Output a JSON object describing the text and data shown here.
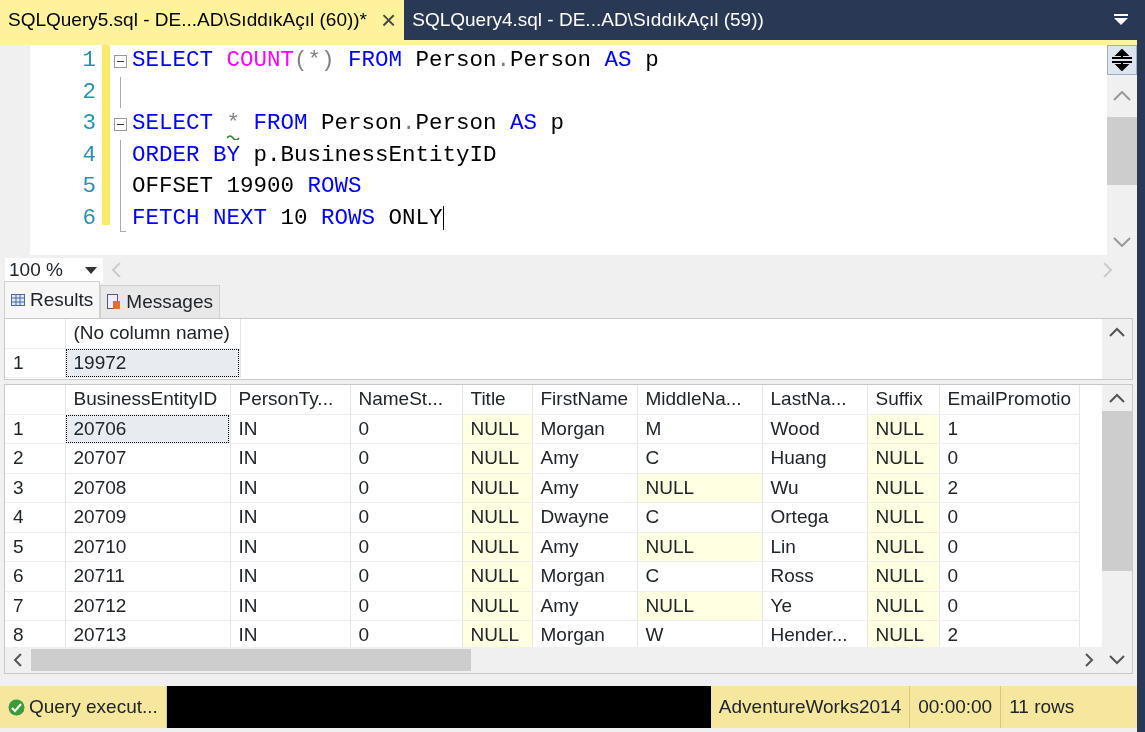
{
  "tabs": [
    {
      "label": "SQLQuery5.sql - DE...AD\\SıddıkAçıl (60))*",
      "selected": true,
      "close": "×"
    },
    {
      "label": "SQLQuery4.sql - DE...AD\\SıddıkAçıl (59))",
      "selected": false
    }
  ],
  "editor": {
    "lines": [
      {
        "number": "1",
        "fold": true,
        "tokens": [
          {
            "kind": "keyword",
            "text": "SELECT"
          },
          {
            "kind": "function",
            "text": " COUNT"
          },
          {
            "kind": "operator",
            "text": "(*)"
          },
          {
            "kind": "keyword",
            "text": " FROM"
          },
          {
            "kind": "plain",
            "text": " Person"
          },
          {
            "kind": "operator",
            "text": "."
          },
          {
            "kind": "plain",
            "text": "Person "
          },
          {
            "kind": "keyword",
            "text": "AS"
          },
          {
            "kind": "plain",
            "text": " p"
          }
        ]
      },
      {
        "number": "2",
        "fold": false
      },
      {
        "number": "3",
        "fold": true,
        "tokens": [
          {
            "kind": "keyword",
            "text": "SELECT "
          },
          {
            "kind": "warning",
            "text": "*"
          },
          {
            "kind": "keyword",
            "text": " FROM"
          },
          {
            "kind": "plain",
            "text": " Person"
          },
          {
            "kind": "operator",
            "text": "."
          },
          {
            "kind": "plain",
            "text": "Person "
          },
          {
            "kind": "keyword",
            "text": "AS"
          },
          {
            "kind": "plain",
            "text": " p"
          }
        ]
      },
      {
        "number": "4",
        "fold": false,
        "tokens": [
          {
            "kind": "keyword",
            "text": "ORDER BY"
          },
          {
            "kind": "plain",
            "text": " p.BusinessEntityID"
          }
        ]
      },
      {
        "number": "5",
        "fold": false,
        "tokens": [
          {
            "kind": "plain",
            "text": "OFFSET 19900 "
          },
          {
            "kind": "keyword",
            "text": "ROWS"
          }
        ]
      },
      {
        "number": "6",
        "fold": false,
        "tokens": [
          {
            "kind": "keyword",
            "text": "FETCH NEXT"
          },
          {
            "kind": "plain",
            "text": " 10 "
          },
          {
            "kind": "keyword",
            "text": "ROWS"
          },
          {
            "kind": "plain",
            "text": " ONLY"
          }
        ]
      }
    ]
  },
  "zoom": {
    "value": "100 %"
  },
  "result_tabs": [
    {
      "label": "Results",
      "selected": true
    },
    {
      "label": "Messages",
      "selected": false
    }
  ],
  "grids": [
    {
      "columns": [
        "(No column name)"
      ],
      "rows": [
        {
          "number": "1",
          "cells": [
            {
              "text": "19972",
              "is_null": false,
              "selected": true
            }
          ]
        }
      ]
    },
    {
      "columns": [
        "BusinessEntityID",
        "PersonTy...",
        "NameSt...",
        "Title",
        "FirstName",
        "MiddleNa...",
        "LastNa...",
        "Suffix",
        "EmailPromotio"
      ],
      "rows": [
        {
          "number": "1",
          "cells": [
            {
              "text": "20706",
              "is_null": false,
              "selected": true
            },
            {
              "text": "IN",
              "is_null": false,
              "selected": false
            },
            {
              "text": "0",
              "is_null": false,
              "selected": false
            },
            {
              "text": "NULL",
              "is_null": true,
              "selected": false
            },
            {
              "text": "Morgan",
              "is_null": false,
              "selected": false
            },
            {
              "text": "M",
              "is_null": false,
              "selected": false
            },
            {
              "text": "Wood",
              "is_null": false,
              "selected": false
            },
            {
              "text": "NULL",
              "is_null": true,
              "selected": false
            },
            {
              "text": "1",
              "is_null": false,
              "selected": false
            }
          ]
        },
        {
          "number": "2",
          "cells": [
            {
              "text": "20707",
              "is_null": false,
              "selected": false
            },
            {
              "text": "IN",
              "is_null": false,
              "selected": false
            },
            {
              "text": "0",
              "is_null": false,
              "selected": false
            },
            {
              "text": "NULL",
              "is_null": true,
              "selected": false
            },
            {
              "text": "Amy",
              "is_null": false,
              "selected": false
            },
            {
              "text": "C",
              "is_null": false,
              "selected": false
            },
            {
              "text": "Huang",
              "is_null": false,
              "selected": false
            },
            {
              "text": "NULL",
              "is_null": true,
              "selected": false
            },
            {
              "text": "0",
              "is_null": false,
              "selected": false
            }
          ]
        },
        {
          "number": "3",
          "cells": [
            {
              "text": "20708",
              "is_null": false,
              "selected": false
            },
            {
              "text": "IN",
              "is_null": false,
              "selected": false
            },
            {
              "text": "0",
              "is_null": false,
              "selected": false
            },
            {
              "text": "NULL",
              "is_null": true,
              "selected": false
            },
            {
              "text": "Amy",
              "is_null": false,
              "selected": false
            },
            {
              "text": "NULL",
              "is_null": true,
              "selected": false
            },
            {
              "text": "Wu",
              "is_null": false,
              "selected": false
            },
            {
              "text": "NULL",
              "is_null": true,
              "selected": false
            },
            {
              "text": "2",
              "is_null": false,
              "selected": false
            }
          ]
        },
        {
          "number": "4",
          "cells": [
            {
              "text": "20709",
              "is_null": false,
              "selected": false
            },
            {
              "text": "IN",
              "is_null": false,
              "selected": false
            },
            {
              "text": "0",
              "is_null": false,
              "selected": false
            },
            {
              "text": "NULL",
              "is_null": true,
              "selected": false
            },
            {
              "text": "Dwayne",
              "is_null": false,
              "selected": false
            },
            {
              "text": "C",
              "is_null": false,
              "selected": false
            },
            {
              "text": "Ortega",
              "is_null": false,
              "selected": false
            },
            {
              "text": "NULL",
              "is_null": true,
              "selected": false
            },
            {
              "text": "0",
              "is_null": false,
              "selected": false
            }
          ]
        },
        {
          "number": "5",
          "cells": [
            {
              "text": "20710",
              "is_null": false,
              "selected": false
            },
            {
              "text": "IN",
              "is_null": false,
              "selected": false
            },
            {
              "text": "0",
              "is_null": false,
              "selected": false
            },
            {
              "text": "NULL",
              "is_null": true,
              "selected": false
            },
            {
              "text": "Amy",
              "is_null": false,
              "selected": false
            },
            {
              "text": "NULL",
              "is_null": true,
              "selected": false
            },
            {
              "text": "Lin",
              "is_null": false,
              "selected": false
            },
            {
              "text": "NULL",
              "is_null": true,
              "selected": false
            },
            {
              "text": "0",
              "is_null": false,
              "selected": false
            }
          ]
        },
        {
          "number": "6",
          "cells": [
            {
              "text": "20711",
              "is_null": false,
              "selected": false
            },
            {
              "text": "IN",
              "is_null": false,
              "selected": false
            },
            {
              "text": "0",
              "is_null": false,
              "selected": false
            },
            {
              "text": "NULL",
              "is_null": true,
              "selected": false
            },
            {
              "text": "Morgan",
              "is_null": false,
              "selected": false
            },
            {
              "text": "C",
              "is_null": false,
              "selected": false
            },
            {
              "text": "Ross",
              "is_null": false,
              "selected": false
            },
            {
              "text": "NULL",
              "is_null": true,
              "selected": false
            },
            {
              "text": "0",
              "is_null": false,
              "selected": false
            }
          ]
        },
        {
          "number": "7",
          "cells": [
            {
              "text": "20712",
              "is_null": false,
              "selected": false
            },
            {
              "text": "IN",
              "is_null": false,
              "selected": false
            },
            {
              "text": "0",
              "is_null": false,
              "selected": false
            },
            {
              "text": "NULL",
              "is_null": true,
              "selected": false
            },
            {
              "text": "Amy",
              "is_null": false,
              "selected": false
            },
            {
              "text": "NULL",
              "is_null": true,
              "selected": false
            },
            {
              "text": "Ye",
              "is_null": false,
              "selected": false
            },
            {
              "text": "NULL",
              "is_null": true,
              "selected": false
            },
            {
              "text": "0",
              "is_null": false,
              "selected": false
            }
          ]
        },
        {
          "number": "8",
          "cells": [
            {
              "text": "20713",
              "is_null": false,
              "selected": false
            },
            {
              "text": "IN",
              "is_null": false,
              "selected": false
            },
            {
              "text": "0",
              "is_null": false,
              "selected": false
            },
            {
              "text": "NULL",
              "is_null": true,
              "selected": false
            },
            {
              "text": "Morgan",
              "is_null": false,
              "selected": false
            },
            {
              "text": "W",
              "is_null": false,
              "selected": false
            },
            {
              "text": "Hender...",
              "is_null": false,
              "selected": false
            },
            {
              "text": "NULL",
              "is_null": true,
              "selected": false
            },
            {
              "text": "2",
              "is_null": false,
              "selected": false
            }
          ]
        }
      ]
    }
  ],
  "status_bar": {
    "message": "Query execut...",
    "database": "AdventureWorks2014",
    "elapsed": "00:00:00",
    "row_count": "11 rows"
  }
}
